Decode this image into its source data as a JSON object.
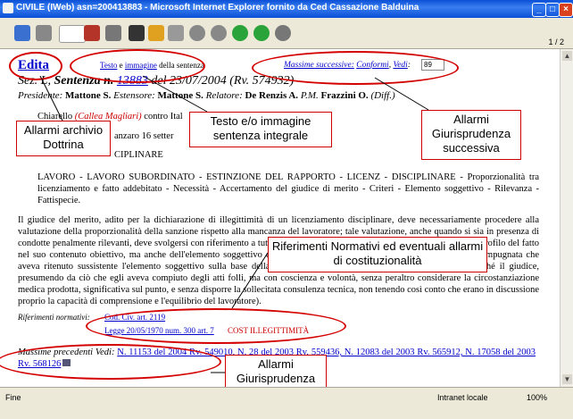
{
  "window": {
    "title": "CIVILE (IWeb) asn=200413883 - Microsoft Internet Explorer fornito da Ced Cassazione Balduina",
    "minimize_icon": "minimize-icon",
    "maximize_icon": "maximize-icon",
    "close_icon": "close-icon"
  },
  "toolbar": {
    "page_count": "1 / 2",
    "buttons": [
      "undo-icon",
      "glasses-icon",
      "print-icon",
      "books-icon",
      "tree-icon",
      "save-icon",
      "folder-icon",
      "printer-icon",
      "stop-icon",
      "circle-icon",
      "forward-icon",
      "next-icon",
      "settings-icon"
    ]
  },
  "document": {
    "edita": "Edita",
    "testo_link": "Testo",
    "e_text": " e ",
    "immagine_link": "immagine",
    "della_sentenza": " della sentenza",
    "massime_label": "Massime successive:",
    "conformi_link": "Conformi",
    "vedi_link": "Vedi",
    "massime_input_value": "89",
    "header_line": {
      "sez": "Sez. L, ",
      "sentenza": "Sentenza n. ",
      "numero": "13883",
      "del": " del 23/07/2004 (Rv. 574932)"
    },
    "president_line": {
      "presidente_label": "Presidente: ",
      "presidente": "Mattone S. ",
      "estensore_label": "Estensore: ",
      "estensore": "Mattone S. ",
      "relatore_label": "Relatore: ",
      "relatore": "De Renzis A. ",
      "pm_label": "P.M. ",
      "pm": "Frazzini O. ",
      "diff": "(Diff.)"
    },
    "parties": {
      "chiarello": "Chiarello ",
      "callea": "(Callea Magliari)",
      "contro": " contro Ital"
    },
    "date_fragment": "anzaro 16 setter",
    "section_title": "CIPLINARE",
    "classification": "LAVORO - LAVORO SUBORDINATO - ESTINZIONE DEL RAPPORTO - LICENZ - DISCIPLINARE - Proporzionalità tra licenziamento e fatto addebitato - Necessità - Accertamento del giudice di merito - Criteri - Elemento soggettivo - Rilevanza - Fattispecie.",
    "massima_text": "Il giudice del merito, adito per la dichiarazione di illegittimità di un licenziamento disciplinare, deve necessariamente procedere alla valutazione della proporzionalità della sanzione rispetto alla mancanza del lavoratore; tale valutazione, anche quando si sia in presenza di condotte penalmente rilevanti, deve svolgersi con riferimento a tutti gli elementi della fattispecie e quindi non solo sotto il profilo del fatto nel suo contenuto obiettivo, ma anche dell'elemento soggettivo e intenzionale della condotta. (Nella specie la sentenza impugnata che aveva ritenuto sussistente l'elemento soggettivo sulla base della dichiarazione resa dal lavoratore, è stata cassata perché il giudice, presumendo da ciò che egli aveva compiuto degli atti folli, ma con coscienza e volontà, senza peraltro considerare la circostanziazione medica prodotta, significativa sul punto, e senza disporre la sollecitata consulenza tecnica, non tenendo così conto che erano in discussione proprio la capacità di comprensione e l'equilibrio del lavoratore).",
    "riferimenti_label": "Riferimenti normativi:",
    "riferimenti_1": "Cod. Civ. art. 2119",
    "riferimenti_2": "Legge 20/05/1970 num. 300 art. 7",
    "cost_illegittimita": "COST ILLEGITTIMITÀ",
    "massime_precedenti_label": "Massime precedenti Vedi: ",
    "massime_precedenti_links": "N. 11153 del 2004 Rv. 549010, N. 28 del 2003 Rv. 559436, N. 12083 del 2003 Rv. 565912, N. 17058 del 2003 Rv. 568126"
  },
  "annotations": {
    "allarmi_dottrina": "Allarmi archivio Dottrina",
    "testo_immagine": "Testo e/o immagine sentenza integrale",
    "allarmi_successiva": "Allarmi Giurisprudenza successiva",
    "riferimenti_normativi": "Riferimenti Normativi ed eventuali allarmi di costituzionalità",
    "allarmi_precedente": "Allarmi Giurisprudenza precedente"
  },
  "statusbar": {
    "status": "Fine",
    "zone": "Intranet locale",
    "zoom": "100%"
  },
  "colors": {
    "link": "#0000cc",
    "annotation_border": "#d40000",
    "title_bar": "#0a4fd6"
  }
}
